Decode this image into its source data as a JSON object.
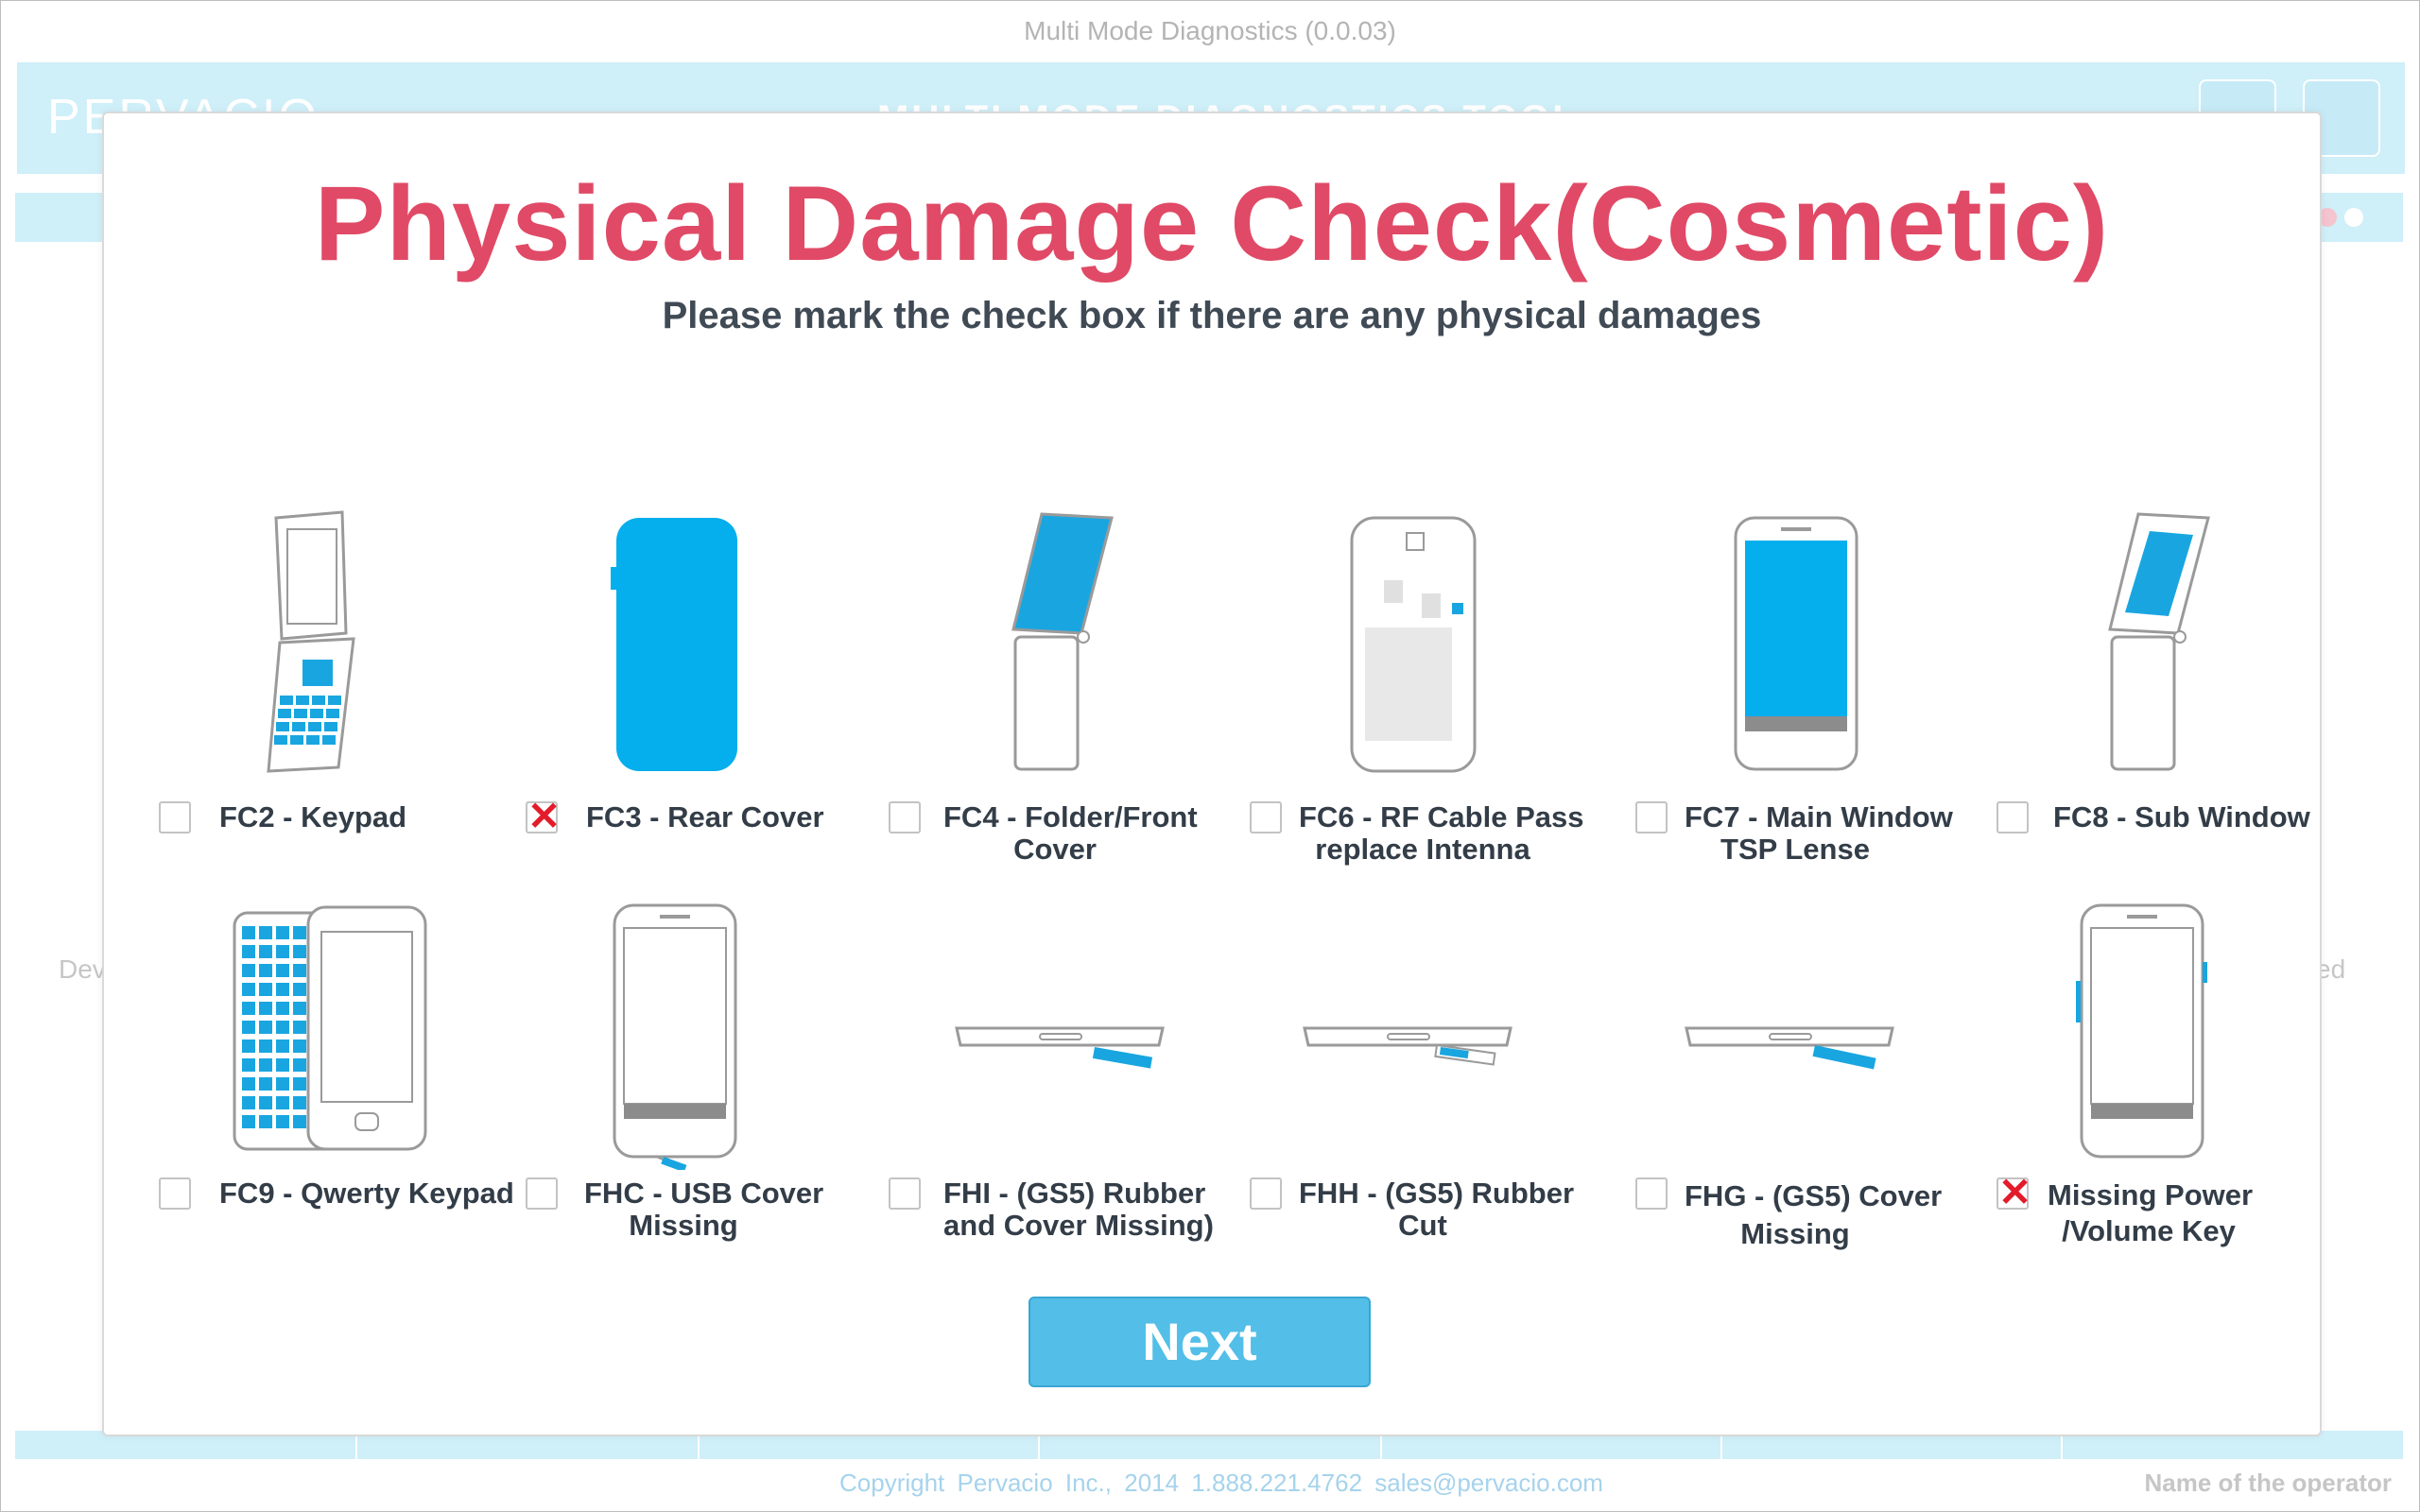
{
  "window": {
    "title": "Multi Mode Diagnostics (0.0.03)"
  },
  "header": {
    "brand": "PERVACIO",
    "app_heading": "MULTI MODE DIAGNOSTICS TOOL"
  },
  "background": {
    "side_left_text": "Dev",
    "side_right_text": "ed"
  },
  "footer": {
    "copyright": "Copyright Pervacio Inc., 2014  1.888.221.4762   sales@pervacio.com",
    "operator": "Name of the operator"
  },
  "modal": {
    "title": "Physical Damage Check(Cosmetic)",
    "subtitle": "Please mark the check box if there are any physical damages",
    "next_label": "Next"
  },
  "items": [
    {
      "line1": "FC2 - Keypad",
      "line2": "",
      "checked": false,
      "icon": "flip-phone-keypad-icon"
    },
    {
      "line1": "FC3 - Rear Cover",
      "line2": "",
      "checked": true,
      "icon": "phone-rear-cover-icon"
    },
    {
      "line1": "FC4 - Folder/Front",
      "line2": "Cover",
      "checked": false,
      "icon": "flip-phone-folder-icon"
    },
    {
      "line1": "FC6 - RF Cable Pass",
      "line2": "replace Intenna",
      "checked": false,
      "icon": "phone-back-internals-icon"
    },
    {
      "line1": "FC7 - Main Window",
      "line2": "TSP Lense",
      "checked": false,
      "icon": "phone-main-window-icon"
    },
    {
      "line1": "FC8 - Sub Window",
      "line2": "",
      "checked": false,
      "icon": "flip-phone-sub-window-icon"
    },
    {
      "line1": "FC9 - Qwerty Keypad",
      "line2": "",
      "checked": false,
      "icon": "slider-qwerty-phone-icon"
    },
    {
      "line1": "FHC - USB Cover",
      "line2": "Missing",
      "checked": false,
      "icon": "phone-usb-cover-icon"
    },
    {
      "line1": "FHI - (GS5) Rubber",
      "line2": "and Cover Missing)",
      "checked": false,
      "icon": "phone-bottom-edge-cover-icon"
    },
    {
      "line1": "FHH - (GS5) Rubber",
      "line2": "Cut",
      "checked": false,
      "icon": "phone-bottom-edge-rubber-icon"
    },
    {
      "line1": "FHG - (GS5) Cover",
      "line2": "Missing",
      "checked": false,
      "icon": "phone-bottom-edge-gs5-cover-icon"
    },
    {
      "line1": "Missing Power",
      "line2": "/Volume Key",
      "checked": true,
      "icon": "phone-side-keys-icon"
    }
  ]
}
